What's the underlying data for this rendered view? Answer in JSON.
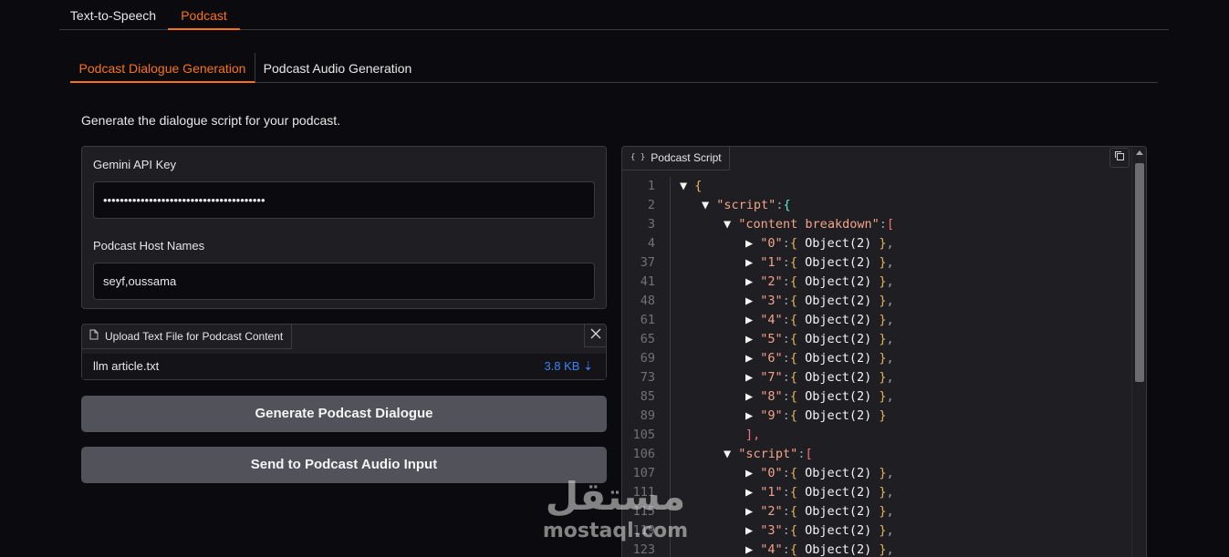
{
  "top_tabs": [
    {
      "label": "Text-to-Speech"
    },
    {
      "label": "Podcast"
    }
  ],
  "sub_tabs": [
    {
      "label": "Podcast Dialogue Generation"
    },
    {
      "label": "Podcast Audio Generation"
    }
  ],
  "description": "Generate the dialogue script for your podcast.",
  "form": {
    "api_key_label": "Gemini API Key",
    "api_key_value": "•••••••••••••••••••••••••••••••••••••••",
    "host_names_label": "Podcast Host Names",
    "host_names_value": "seyf,oussama"
  },
  "upload": {
    "label": "Upload Text File for Podcast Content",
    "file_name": "llm article.txt",
    "file_size": "3.8 KB"
  },
  "buttons": {
    "generate": "Generate Podcast Dialogue",
    "send": "Send to Podcast Audio Input"
  },
  "json_panel": {
    "label": "Podcast Script",
    "lines": [
      {
        "ln": "1",
        "indent": 0,
        "toggle": "▼",
        "key": "",
        "open": "{",
        "bracket": "br1"
      },
      {
        "ln": "2",
        "indent": 1,
        "toggle": "▼",
        "key": "\"script\"",
        "open": "{",
        "bracket": "br3"
      },
      {
        "ln": "3",
        "indent": 2,
        "toggle": "▼",
        "key": "\"content breakdown\"",
        "open": "[",
        "bracket": "br2"
      },
      {
        "ln": "4",
        "indent": 3,
        "toggle": "▶",
        "key": "\"0\"",
        "obj": "Object(2)",
        "trail": ","
      },
      {
        "ln": "37",
        "indent": 3,
        "toggle": "▶",
        "key": "\"1\"",
        "obj": "Object(2)",
        "trail": ","
      },
      {
        "ln": "41",
        "indent": 3,
        "toggle": "▶",
        "key": "\"2\"",
        "obj": "Object(2)",
        "trail": ","
      },
      {
        "ln": "48",
        "indent": 3,
        "toggle": "▶",
        "key": "\"3\"",
        "obj": "Object(2)",
        "trail": ","
      },
      {
        "ln": "61",
        "indent": 3,
        "toggle": "▶",
        "key": "\"4\"",
        "obj": "Object(2)",
        "trail": ","
      },
      {
        "ln": "65",
        "indent": 3,
        "toggle": "▶",
        "key": "\"5\"",
        "obj": "Object(2)",
        "trail": ","
      },
      {
        "ln": "69",
        "indent": 3,
        "toggle": "▶",
        "key": "\"6\"",
        "obj": "Object(2)",
        "trail": ","
      },
      {
        "ln": "73",
        "indent": 3,
        "toggle": "▶",
        "key": "\"7\"",
        "obj": "Object(2)",
        "trail": ","
      },
      {
        "ln": "85",
        "indent": 3,
        "toggle": "▶",
        "key": "\"8\"",
        "obj": "Object(2)",
        "trail": ","
      },
      {
        "ln": "89",
        "indent": 3,
        "toggle": "▶",
        "key": "\"9\"",
        "obj": "Object(2)",
        "trail": ""
      },
      {
        "ln": "105",
        "indent": 3,
        "close": "],"
      },
      {
        "ln": "106",
        "indent": 2,
        "toggle": "▼",
        "key": "\"script\"",
        "open": "[",
        "bracket": "br2"
      },
      {
        "ln": "107",
        "indent": 3,
        "toggle": "▶",
        "key": "\"0\"",
        "obj": "Object(2)",
        "trail": ","
      },
      {
        "ln": "111",
        "indent": 3,
        "toggle": "▶",
        "key": "\"1\"",
        "obj": "Object(2)",
        "trail": ","
      },
      {
        "ln": "115",
        "indent": 3,
        "toggle": "▶",
        "key": "\"2\"",
        "obj": "Object(2)",
        "trail": ","
      },
      {
        "ln": "119",
        "indent": 3,
        "toggle": "▶",
        "key": "\"3\"",
        "obj": "Object(2)",
        "trail": ","
      },
      {
        "ln": "123",
        "indent": 3,
        "toggle": "▶",
        "key": "\"4\"",
        "obj": "Object(2)",
        "trail": ","
      }
    ]
  },
  "watermark": {
    "arabic": "مستقل",
    "latin": "mostaql.com"
  },
  "colors": {
    "accent": "#f97316",
    "background": "#0b0b0f",
    "panel": "#1f1f23",
    "button": "#52525b",
    "link": "#3b82f6"
  },
  "icons": [
    "file-icon",
    "close-icon",
    "json-braces-icon",
    "copy-icon",
    "download-icon"
  ]
}
